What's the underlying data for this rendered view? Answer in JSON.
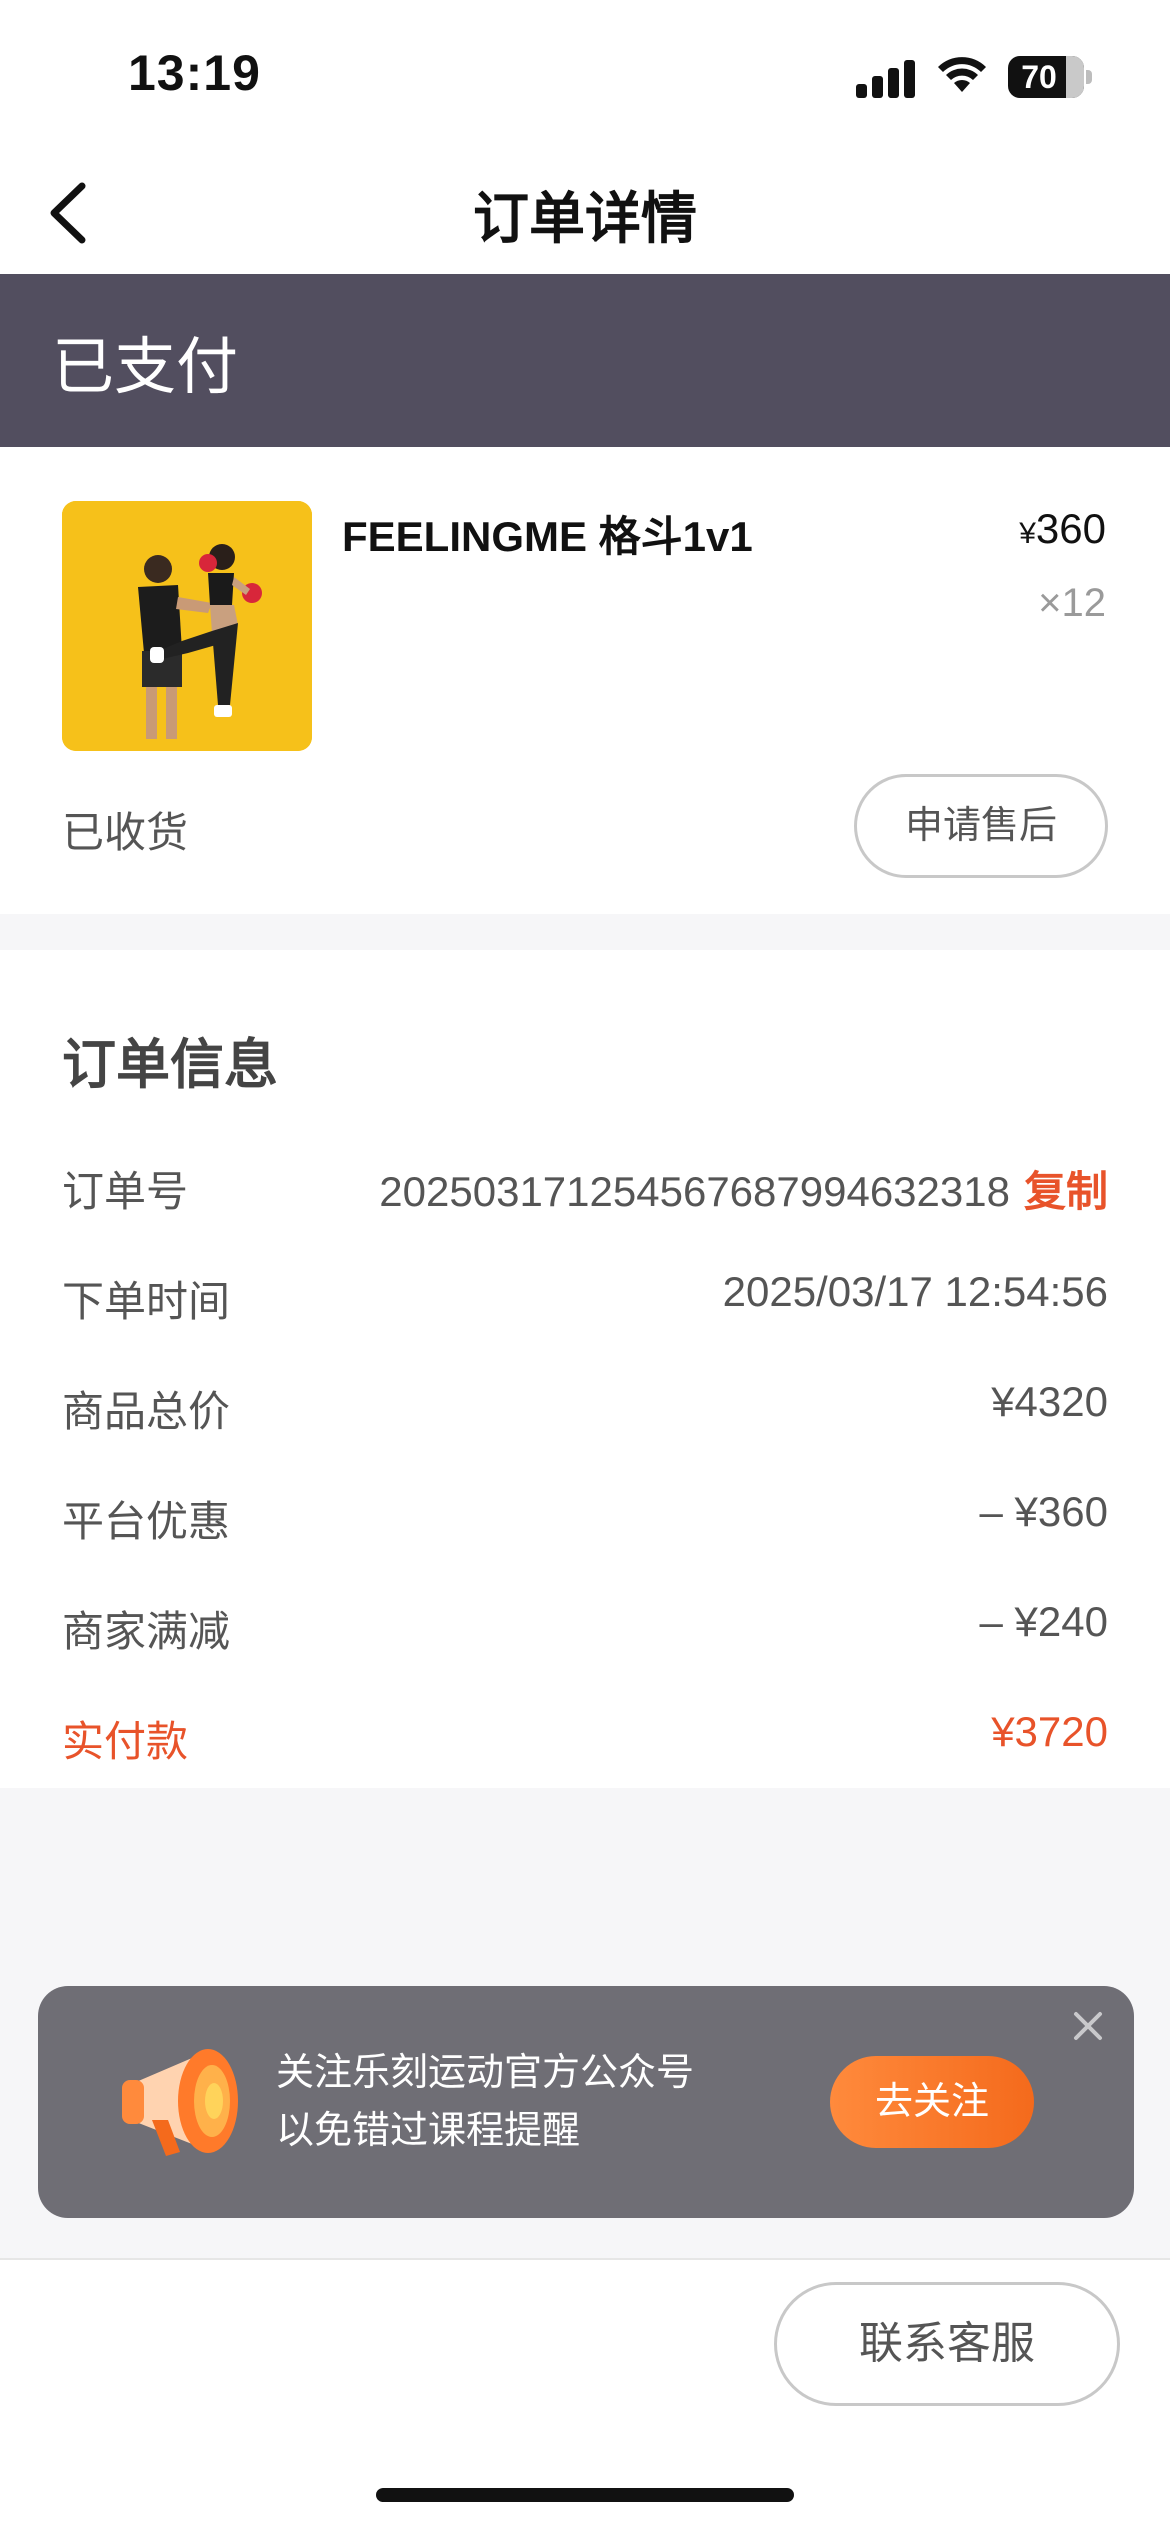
{
  "status_bar": {
    "time": "13:19",
    "battery": "70"
  },
  "nav": {
    "title": "订单详情",
    "back_icon": "chevron-left-icon"
  },
  "order_status": {
    "label": "已支付",
    "color": "#524e5f"
  },
  "product": {
    "name": "FEELINGME 格斗1v1",
    "price_symbol": "¥",
    "price": "360",
    "quantity": "×12",
    "receipt_status": "已收货",
    "after_sale_label": "申请售后"
  },
  "order_info": {
    "title": "订单信息",
    "rows": [
      {
        "label": "订单号",
        "value": "20250317125456768799463231​8",
        "action": "复制"
      },
      {
        "label": "下单时间",
        "value": "2025/03/17 12:54:56"
      },
      {
        "label": "商品总价",
        "value": "¥4320"
      },
      {
        "label": "平台优惠",
        "value": "– ¥360"
      },
      {
        "label": "商家满减",
        "value": "– ¥240"
      },
      {
        "label": "实付款",
        "value": "¥3720"
      }
    ],
    "accent_color": "#e8532a"
  },
  "follow_toast": {
    "line1": "关注乐刻运动官方公众号",
    "line2": "以免错过课程提醒",
    "button_label": "去关注",
    "icon": "megaphone-icon"
  },
  "bottom_bar": {
    "support_label": "联系客服"
  }
}
